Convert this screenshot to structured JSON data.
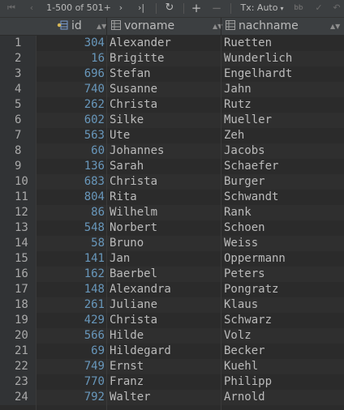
{
  "toolbar": {
    "first_page_icon": "first-page",
    "prev_page_icon": "previous-page",
    "page_info": "1-500 of 501+",
    "next_page_icon": "next-page",
    "last_page_icon": "last-page",
    "reload_icon": "reload",
    "add_row_icon": "plus",
    "delete_row_icon": "minus",
    "tx_label": "Tx: Auto",
    "extra_icon": "db",
    "commit_icon": "checkmark"
  },
  "columns": [
    {
      "label": "id",
      "icon": "key-column"
    },
    {
      "label": "vorname",
      "icon": "table-column"
    },
    {
      "label": "nachname",
      "icon": "table-column"
    }
  ],
  "rows": [
    {
      "num": "1",
      "id": "304",
      "vorname": "Alexander",
      "nachname": "Ruetten"
    },
    {
      "num": "2",
      "id": "16",
      "vorname": "Brigitte",
      "nachname": "Wunderlich"
    },
    {
      "num": "3",
      "id": "696",
      "vorname": "Stefan",
      "nachname": "Engelhardt"
    },
    {
      "num": "4",
      "id": "740",
      "vorname": "Susanne",
      "nachname": "Jahn"
    },
    {
      "num": "5",
      "id": "262",
      "vorname": "Christa",
      "nachname": "Rutz"
    },
    {
      "num": "6",
      "id": "602",
      "vorname": "Silke",
      "nachname": "Mueller"
    },
    {
      "num": "7",
      "id": "563",
      "vorname": "Ute",
      "nachname": "Zeh"
    },
    {
      "num": "8",
      "id": "60",
      "vorname": "Johannes",
      "nachname": "Jacobs"
    },
    {
      "num": "9",
      "id": "136",
      "vorname": "Sarah",
      "nachname": "Schaefer"
    },
    {
      "num": "10",
      "id": "683",
      "vorname": "Christa",
      "nachname": "Burger"
    },
    {
      "num": "11",
      "id": "804",
      "vorname": "Rita",
      "nachname": "Schwandt"
    },
    {
      "num": "12",
      "id": "86",
      "vorname": "Wilhelm",
      "nachname": "Rank"
    },
    {
      "num": "13",
      "id": "548",
      "vorname": "Norbert",
      "nachname": "Schoen"
    },
    {
      "num": "14",
      "id": "58",
      "vorname": "Bruno",
      "nachname": "Weiss"
    },
    {
      "num": "15",
      "id": "141",
      "vorname": "Jan",
      "nachname": "Oppermann"
    },
    {
      "num": "16",
      "id": "162",
      "vorname": "Baerbel",
      "nachname": "Peters"
    },
    {
      "num": "17",
      "id": "148",
      "vorname": "Alexandra",
      "nachname": "Pongratz"
    },
    {
      "num": "18",
      "id": "261",
      "vorname": "Juliane",
      "nachname": "Klaus"
    },
    {
      "num": "19",
      "id": "429",
      "vorname": "Christa",
      "nachname": "Schwarz"
    },
    {
      "num": "20",
      "id": "566",
      "vorname": "Hilde",
      "nachname": "Volz"
    },
    {
      "num": "21",
      "id": "69",
      "vorname": "Hildegard",
      "nachname": "Becker"
    },
    {
      "num": "22",
      "id": "749",
      "vorname": "Ernst",
      "nachname": "Kuehl"
    },
    {
      "num": "23",
      "id": "770",
      "vorname": "Franz",
      "nachname": "Philipp"
    },
    {
      "num": "24",
      "id": "792",
      "vorname": "Walter",
      "nachname": "Arnold"
    }
  ]
}
